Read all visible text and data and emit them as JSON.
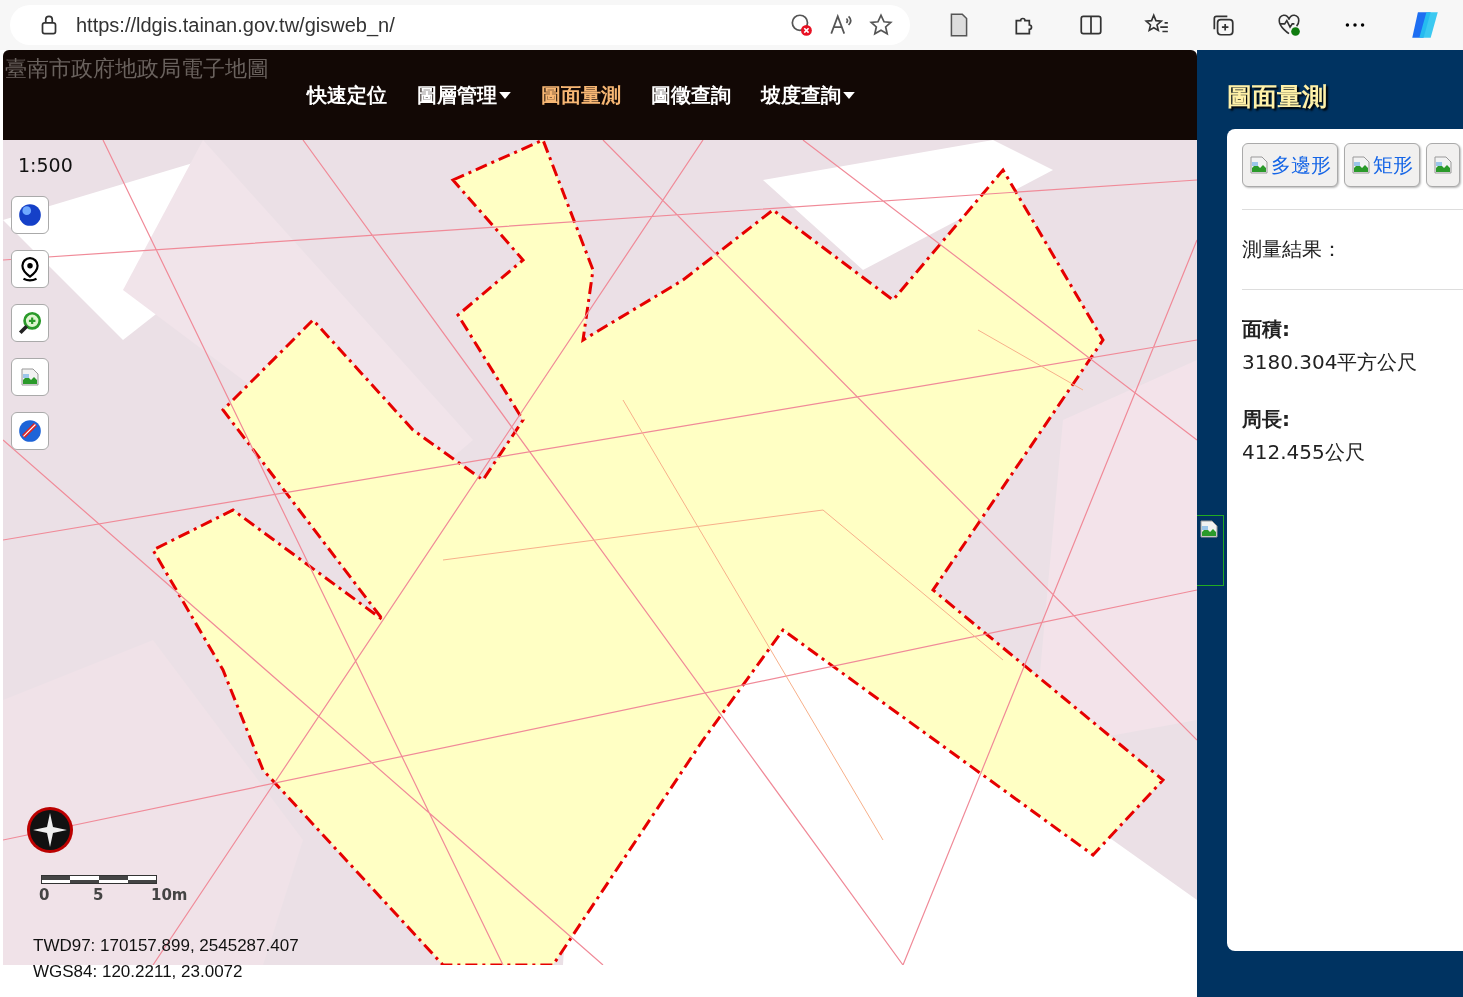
{
  "browser": {
    "url": "https://ldgis.tainan.gov.tw/gisweb_n/"
  },
  "header": {
    "title": "臺南市政府地政局電子地圖",
    "nav": [
      {
        "label": "快速定位",
        "selected": false,
        "dropdown": false
      },
      {
        "label": "圖層管理",
        "selected": false,
        "dropdown": true
      },
      {
        "label": "圖面量測",
        "selected": true,
        "dropdown": false
      },
      {
        "label": "圖徵查詢",
        "selected": false,
        "dropdown": false
      },
      {
        "label": "坡度查詢",
        "selected": false,
        "dropdown": true
      }
    ]
  },
  "map": {
    "scale": "1:500",
    "scale_bar": [
      "0",
      "5",
      "10m"
    ],
    "coordinates": [
      "TWD97: 170157.899, 2545287.407",
      "WGS84: 120.2211, 23.0072"
    ]
  },
  "panel": {
    "title": "圖面量測",
    "tools": [
      {
        "kind": "labeled",
        "label": "多邊形"
      },
      {
        "kind": "labeled",
        "label": "矩形"
      },
      {
        "kind": "image_only"
      }
    ],
    "result_label": "測量結果：",
    "results": [
      {
        "label": "面積:",
        "value": "3180.304平方公尺"
      },
      {
        "label": "周長:",
        "value": "412.455公尺"
      }
    ]
  }
}
